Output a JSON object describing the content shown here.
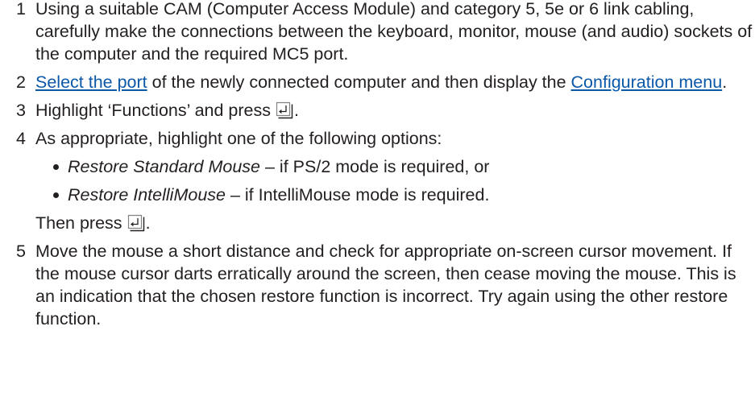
{
  "steps": [
    {
      "num": "1",
      "text": "Using a suitable CAM (Computer Access Module) and category 5, 5e or 6 link cabling, carefully make the connections between the keyboard, monitor, mouse (and audio) sockets of the computer and the required MC5 port."
    },
    {
      "num": "2",
      "link1": "Select the port",
      "mid": " of the newly connected computer and then display the ",
      "link2": "Configuration menu",
      "end": "."
    },
    {
      "num": "3",
      "text": "Highlight ‘Functions’ and press",
      "end": "."
    },
    {
      "num": "4",
      "text": "As appropriate, highlight one of the following options:",
      "options": [
        {
          "name": "Restore Standard Mouse",
          "desc": " – if PS/2 mode is required, or"
        },
        {
          "name": "Restore IntelliMouse",
          "desc": " – if IntelliMouse mode is required."
        }
      ],
      "then": "Then press",
      "then_end": "."
    },
    {
      "num": "5",
      "text": "Move the mouse a short distance and check for appropriate on-screen cursor movement. If the mouse cursor darts erratically around the screen, then cease moving the mouse. This is an indication that the chosen restore function is incorrect. Try again using the other restore function."
    }
  ],
  "icons": {
    "enter_key": "enter-key-icon"
  },
  "colors": {
    "text": "#231f20",
    "link": "#0b57a8"
  }
}
